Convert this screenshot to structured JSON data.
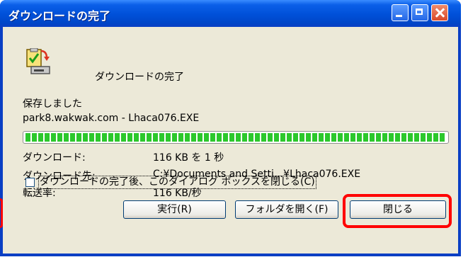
{
  "window": {
    "title": "ダウンロードの完了",
    "controls": {
      "minimize_icon": "minimize-icon",
      "maximize_icon": "maximize-icon",
      "close_icon": "close-icon"
    }
  },
  "header": {
    "icon": "download-complete-icon",
    "label": "ダウンロードの完了"
  },
  "status": {
    "saved_text": "保存しました",
    "filename": "park8.wakwak.com - Lhaca076.EXE",
    "progress": 1.0
  },
  "details": [
    {
      "label": "ダウンロード:",
      "value": "116 KB を 1 秒"
    },
    {
      "label": "ダウンロード先:",
      "value": "C:¥Documents and Setti...¥Lhaca076.EXE"
    },
    {
      "label": "転送率:",
      "value": "116 KB/秒"
    }
  ],
  "checkbox": {
    "checked": false,
    "label": "ダウンロードの完了後、このダイアログ ボックスを閉じる(C)"
  },
  "buttons": {
    "run": "実行(R)",
    "open_folder": "フォルダを開く(F)",
    "close": "閉じる"
  },
  "colors": {
    "titlebar": "#0050d8",
    "client": "#ece9d8",
    "progress": "#2cc82c",
    "highlight": "#ff0000"
  }
}
